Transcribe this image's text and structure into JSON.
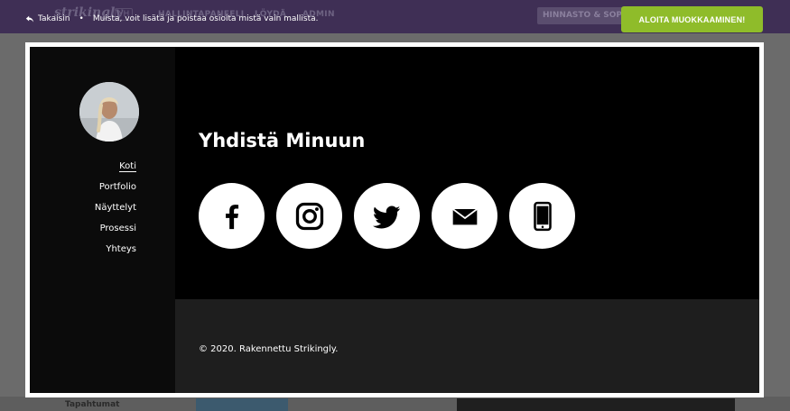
{
  "app": {
    "logo": "strikingly",
    "lang": "YH",
    "nav": [
      "HALLINTAPANEELI",
      "LÖYDÄ",
      "ADMIN"
    ],
    "pricing_label": "HINNASTO & SOPIMUS"
  },
  "editor_bar": {
    "back_label": "Takaisin",
    "notice": "Muista, voit lisätä ja poistaa osioita mistä vain mallista.",
    "cta_label": "ALOITA MUOKKAAMINEN!"
  },
  "site": {
    "nav_items": [
      {
        "label": "Koti",
        "active": true
      },
      {
        "label": "Portfolio",
        "active": false
      },
      {
        "label": "Näyttelyt",
        "active": false
      },
      {
        "label": "Prosessi",
        "active": false
      },
      {
        "label": "Yhteys",
        "active": false
      }
    ],
    "section_title": "Yhdistä Minuun",
    "socials": [
      {
        "name": "facebook-icon"
      },
      {
        "name": "instagram-icon"
      },
      {
        "name": "twitter-icon"
      },
      {
        "name": "email-icon"
      },
      {
        "name": "phone-icon"
      }
    ],
    "footer_text": "© 2020. Rakennettu Strikingly."
  },
  "background": {
    "below_label": "Tapahtumat"
  },
  "colors": {
    "topbar": "#3f2f55",
    "cta": "#8fbc2a",
    "footer": "#1e1e1e"
  }
}
